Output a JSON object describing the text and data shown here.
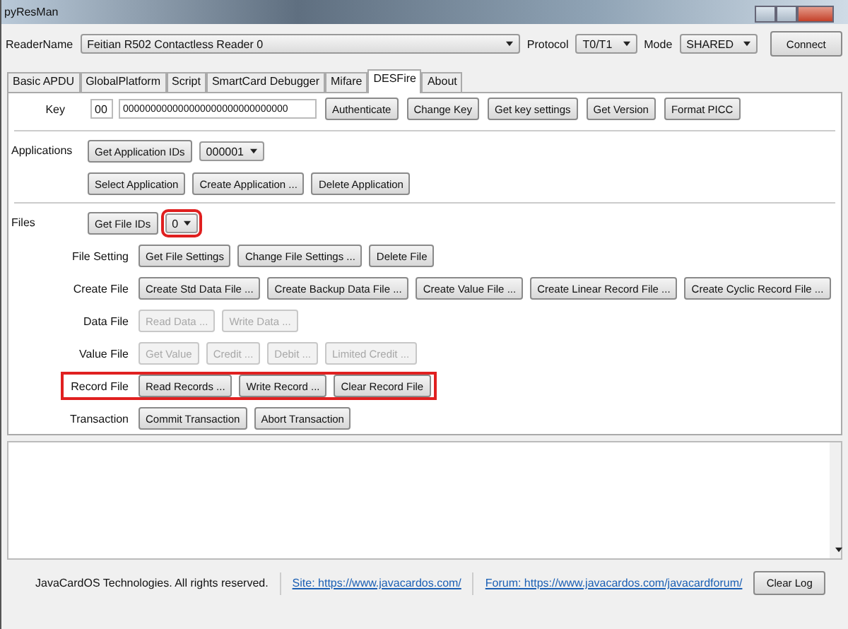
{
  "window": {
    "title": "pyResMan"
  },
  "reader": {
    "label": "ReaderName",
    "value": "Feitian R502 Contactless Reader 0"
  },
  "protocol": {
    "label": "Protocol",
    "value": "T0/T1"
  },
  "mode": {
    "label": "Mode",
    "value": "SHARED"
  },
  "connect_button": "Connect",
  "tabs": [
    {
      "label": "Basic APDU",
      "selected": false
    },
    {
      "label": "GlobalPlatform",
      "selected": false
    },
    {
      "label": "Script",
      "selected": false
    },
    {
      "label": "SmartCard Debugger",
      "selected": false
    },
    {
      "label": "Mifare",
      "selected": false
    },
    {
      "label": "DESFire",
      "selected": true
    },
    {
      "label": "About",
      "selected": false
    }
  ],
  "key": {
    "label": "Key",
    "key_no": "00",
    "key_value": "000000000000000000000000000000",
    "buttons": [
      "Authenticate",
      "Change Key",
      "Get key settings",
      "Get Version",
      "Format PICC"
    ]
  },
  "sections": [
    {
      "label": "Applications",
      "rows": [
        {
          "items": [
            {
              "kind": "button",
              "text": "Get Application IDs",
              "disabled": false
            },
            {
              "kind": "dropdown",
              "value": "000001",
              "highlighted": false
            }
          ]
        },
        {
          "items": [
            {
              "kind": "button",
              "text": "Select Application",
              "disabled": false
            },
            {
              "kind": "button",
              "text": "Create Application ...",
              "disabled": false
            },
            {
              "kind": "button",
              "text": "Delete Application",
              "disabled": false
            }
          ]
        }
      ]
    },
    {
      "label": "Files",
      "rows": [
        {
          "items": [
            {
              "kind": "button",
              "text": "Get File IDs",
              "disabled": false
            },
            {
              "kind": "dropdown",
              "value": "0",
              "highlighted": true
            }
          ]
        },
        {
          "label": "File Setting",
          "highlighted": false,
          "items": [
            {
              "kind": "button",
              "text": "Get File Settings",
              "disabled": false
            },
            {
              "kind": "button",
              "text": "Change File Settings ...",
              "disabled": false
            },
            {
              "kind": "button",
              "text": "Delete File",
              "disabled": false
            }
          ]
        },
        {
          "label": "Create File",
          "highlighted": false,
          "items": [
            {
              "kind": "button",
              "text": "Create Std Data File ...",
              "disabled": false
            },
            {
              "kind": "button",
              "text": "Create Backup Data File ...",
              "disabled": false
            },
            {
              "kind": "button",
              "text": "Create Value File ...",
              "disabled": false
            },
            {
              "kind": "button",
              "text": "Create Linear Record File ...",
              "disabled": false
            },
            {
              "kind": "button",
              "text": "Create Cyclic Record File ...",
              "disabled": false
            }
          ]
        },
        {
          "label": "Data File",
          "highlighted": false,
          "items": [
            {
              "kind": "button",
              "text": "Read Data ...",
              "disabled": true
            },
            {
              "kind": "button",
              "text": "Write Data ...",
              "disabled": true
            }
          ]
        },
        {
          "label": "Value File",
          "highlighted": false,
          "items": [
            {
              "kind": "button",
              "text": "Get Value",
              "disabled": true
            },
            {
              "kind": "button",
              "text": "Credit ...",
              "disabled": true
            },
            {
              "kind": "button",
              "text": "Debit ...",
              "disabled": true
            },
            {
              "kind": "button",
              "text": "Limited Credit ...",
              "disabled": true
            }
          ]
        },
        {
          "label": "Record File",
          "highlighted": true,
          "items": [
            {
              "kind": "button",
              "text": "Read Records ...",
              "disabled": false
            },
            {
              "kind": "button",
              "text": "Write Record ...",
              "disabled": false
            },
            {
              "kind": "button",
              "text": "Clear Record File",
              "disabled": false
            }
          ]
        },
        {
          "label": "Transaction",
          "highlighted": false,
          "items": [
            {
              "kind": "button",
              "text": "Commit Transaction",
              "disabled": false
            },
            {
              "kind": "button",
              "text": "Abort Transaction",
              "disabled": false
            }
          ]
        }
      ]
    }
  ],
  "footer": {
    "copyright": "JavaCardOS Technologies. All rights reserved.",
    "site_link": "Site: https://www.javacardos.com/",
    "forum_link": "Forum: https://www.javacardos.com/javacardforum/",
    "clear_button": "Clear Log"
  }
}
